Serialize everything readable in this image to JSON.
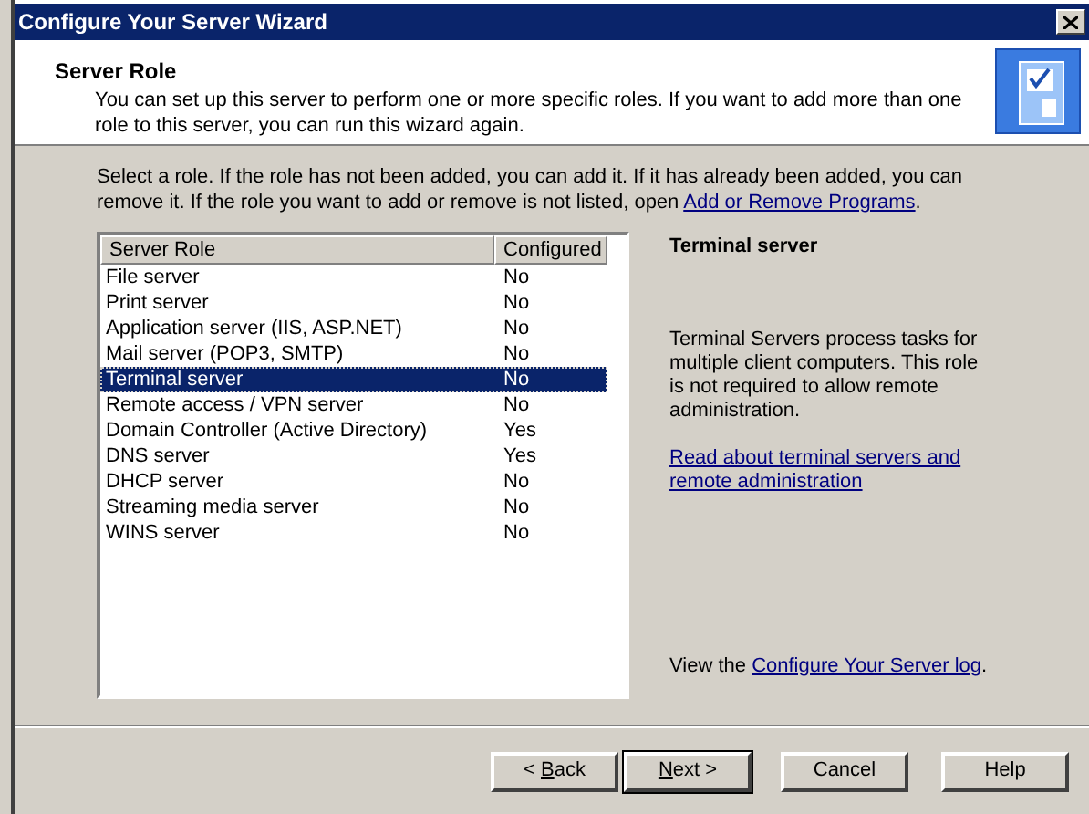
{
  "window": {
    "title": "Configure Your Server Wizard"
  },
  "header": {
    "title": "Server Role",
    "description": "You can set up this server to perform one or more specific roles. If you want to add more than one role to this server, you can run this wizard again."
  },
  "instructions": {
    "text": "Select a role. If the role has not been added, you can add it. If it has already been added, you can remove it. If the role you want to add or remove is not listed, open",
    "link": "Add or Remove Programs",
    "end": "."
  },
  "table": {
    "columns": [
      "Server Role",
      "Configured"
    ],
    "rows": [
      {
        "role": "File server",
        "configured": "No",
        "selected": false
      },
      {
        "role": "Print server",
        "configured": "No",
        "selected": false
      },
      {
        "role": "Application server (IIS, ASP.NET)",
        "configured": "No",
        "selected": false
      },
      {
        "role": "Mail server (POP3, SMTP)",
        "configured": "No",
        "selected": false
      },
      {
        "role": "Terminal server",
        "configured": "No",
        "selected": true
      },
      {
        "role": "Remote access / VPN server",
        "configured": "No",
        "selected": false
      },
      {
        "role": "Domain Controller (Active Directory)",
        "configured": "Yes",
        "selected": false
      },
      {
        "role": "DNS server",
        "configured": "Yes",
        "selected": false
      },
      {
        "role": "DHCP server",
        "configured": "No",
        "selected": false
      },
      {
        "role": "Streaming media server",
        "configured": "No",
        "selected": false
      },
      {
        "role": "WINS server",
        "configured": "No",
        "selected": false
      }
    ]
  },
  "details": {
    "title": "Terminal server",
    "description": "Terminal Servers process tasks for multiple client computers. This role is not required to allow remote administration.",
    "link": "Read about terminal servers and remote administration",
    "log_text": "View the",
    "log_link": "Configure Your Server log",
    "log_end": "."
  },
  "buttons": [
    {
      "label_before": "< ",
      "access_key": "B",
      "label_after": "ack",
      "default": false
    },
    {
      "access_key": "N",
      "label_after": "ext >",
      "default": true
    },
    {
      "label_before": "Cancel",
      "default": false
    },
    {
      "label_before": "Help",
      "default": false
    }
  ]
}
